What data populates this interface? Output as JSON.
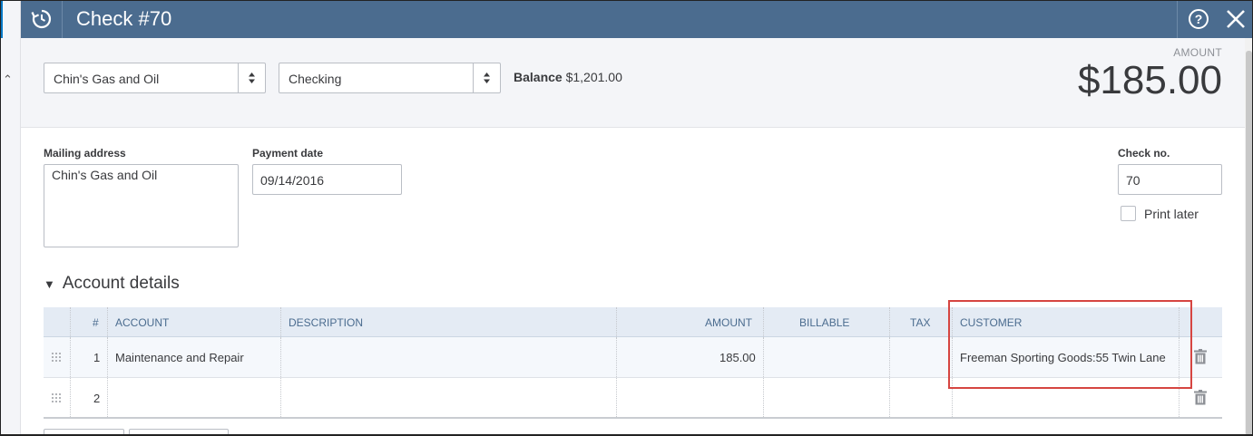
{
  "header": {
    "title": "Check #70"
  },
  "payee": {
    "value": "Chin's Gas and Oil"
  },
  "bank_account": {
    "value": "Checking"
  },
  "balance": {
    "label": "Balance",
    "value": "$1,201.00"
  },
  "amount": {
    "label": "AMOUNT",
    "value": "$185.00"
  },
  "mailing_address": {
    "label": "Mailing address",
    "value": "Chin's Gas and Oil"
  },
  "payment_date": {
    "label": "Payment date",
    "value": "09/14/2016"
  },
  "check_no": {
    "label": "Check no.",
    "value": "70"
  },
  "print_later": {
    "label": "Print later",
    "checked": false
  },
  "account_details": {
    "title": "Account details",
    "columns": [
      "#",
      "ACCOUNT",
      "DESCRIPTION",
      "AMOUNT",
      "BILLABLE",
      "TAX",
      "CUSTOMER"
    ],
    "rows": [
      {
        "num": "1",
        "account": "Maintenance and Repair",
        "description": "",
        "amount": "185.00",
        "billable": "",
        "tax": "",
        "customer": "Freeman Sporting Goods:55 Twin Lane"
      },
      {
        "num": "2",
        "account": "",
        "description": "",
        "amount": "",
        "billable": "",
        "tax": "",
        "customer": ""
      }
    ]
  },
  "colors": {
    "header_bg": "#4b6c8f",
    "highlight": "#d64541",
    "grid_header_bg": "#e4ebf4"
  },
  "icons": {
    "history": "history-icon",
    "help": "help-circle-icon",
    "close": "close-icon",
    "select_arrow": "up-down-arrows-icon",
    "drag": "drag-handle-icon",
    "delete": "trash-icon"
  }
}
